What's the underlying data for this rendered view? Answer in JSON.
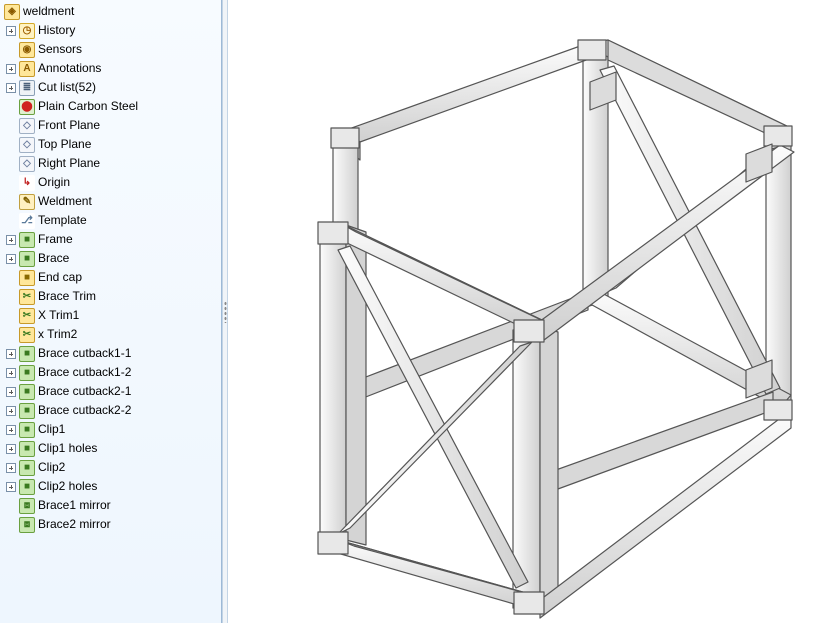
{
  "tree": {
    "root": {
      "label": "weldment",
      "icon": "part",
      "expandable": false
    },
    "items": [
      {
        "label": "History",
        "icon": "history",
        "expandable": true
      },
      {
        "label": "Sensors",
        "icon": "sensor",
        "expandable": false
      },
      {
        "label": "Annotations",
        "icon": "annotation",
        "expandable": true
      },
      {
        "label": "Cut list(52)",
        "icon": "cutlist",
        "expandable": true
      },
      {
        "label": "Plain Carbon Steel",
        "icon": "material",
        "expandable": false
      },
      {
        "label": "Front Plane",
        "icon": "plane",
        "expandable": false
      },
      {
        "label": "Top Plane",
        "icon": "plane",
        "expandable": false
      },
      {
        "label": "Right Plane",
        "icon": "plane",
        "expandable": false
      },
      {
        "label": "Origin",
        "icon": "origin",
        "expandable": false
      },
      {
        "label": "Weldment",
        "icon": "weldment",
        "expandable": false
      },
      {
        "label": "Template",
        "icon": "sketch3d",
        "expandable": false
      },
      {
        "label": "Frame",
        "icon": "feature",
        "expandable": true
      },
      {
        "label": "Brace",
        "icon": "feature",
        "expandable": true
      },
      {
        "label": "End cap",
        "icon": "featureY",
        "expandable": false
      },
      {
        "label": "Brace Trim",
        "icon": "trim",
        "expandable": false
      },
      {
        "label": "X Trim1",
        "icon": "trim",
        "expandable": false
      },
      {
        "label": "x Trim2",
        "icon": "trim",
        "expandable": false
      },
      {
        "label": "Brace cutback1-1",
        "icon": "feature",
        "expandable": true
      },
      {
        "label": "Brace cutback1-2",
        "icon": "feature",
        "expandable": true
      },
      {
        "label": "Brace cutback2-1",
        "icon": "feature",
        "expandable": true
      },
      {
        "label": "Brace cutback2-2",
        "icon": "feature",
        "expandable": true
      },
      {
        "label": "Clip1",
        "icon": "feature",
        "expandable": true
      },
      {
        "label": "Clip1 holes",
        "icon": "feature",
        "expandable": true
      },
      {
        "label": "Clip2",
        "icon": "feature",
        "expandable": true
      },
      {
        "label": "Clip2 holes",
        "icon": "feature",
        "expandable": true
      },
      {
        "label": "Brace1 mirror",
        "icon": "mirror",
        "expandable": false
      },
      {
        "label": "Brace2 mirror",
        "icon": "mirror",
        "expandable": false
      }
    ]
  },
  "icons": {
    "part": {
      "bg": "#ffe79a",
      "border": "#c79a2a",
      "glyph": "◈",
      "color": "#8a5a00"
    },
    "history": {
      "bg": "#fff3c2",
      "border": "#d4aa2a",
      "glyph": "◷",
      "color": "#a06000"
    },
    "sensor": {
      "bg": "#ffe79a",
      "border": "#c79a2a",
      "glyph": "◉",
      "color": "#8a5a00"
    },
    "annotation": {
      "bg": "#ffe79a",
      "border": "#c79a2a",
      "glyph": "A",
      "color": "#8a5a00"
    },
    "cutlist": {
      "bg": "#eef2f6",
      "border": "#8aa0b6",
      "glyph": "≣",
      "color": "#4a607a"
    },
    "material": {
      "bg": "#e0f0d0",
      "border": "#6aa040",
      "glyph": "⬤",
      "color": "#d02020"
    },
    "plane": {
      "bg": "#f4f6fa",
      "border": "#a0b0c4",
      "glyph": "◇",
      "color": "#7080a0"
    },
    "origin": {
      "bg": "#ffffff",
      "border": "#ffffff",
      "glyph": "↳",
      "color": "#c02020"
    },
    "weldment": {
      "bg": "#fff0c0",
      "border": "#c0a040",
      "glyph": "✎",
      "color": "#806000"
    },
    "sketch3d": {
      "bg": "#ffffff",
      "border": "#ffffff",
      "glyph": "⎇",
      "color": "#5a7a9a"
    },
    "feature": {
      "bg": "#c8e8b0",
      "border": "#6aa040",
      "glyph": "■",
      "color": "#3a7a20"
    },
    "featureY": {
      "bg": "#ffe79a",
      "border": "#c79a2a",
      "glyph": "■",
      "color": "#8a6a00"
    },
    "trim": {
      "bg": "#ffe79a",
      "border": "#c79a2a",
      "glyph": "✂",
      "color": "#3a7a20"
    },
    "mirror": {
      "bg": "#c8e8b0",
      "border": "#6aa040",
      "glyph": "⧈",
      "color": "#3a7a20"
    }
  }
}
